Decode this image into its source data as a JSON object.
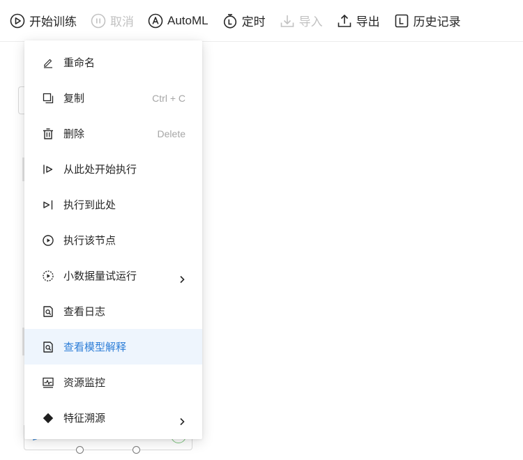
{
  "toolbar": {
    "start_training": "开始训练",
    "cancel": "取消",
    "automl": "AutoML",
    "schedule": "定时",
    "import": "导入",
    "export": "导出",
    "history": "历史记录"
  },
  "context_menu": {
    "items": [
      {
        "label": "重命名",
        "icon": "pencil-icon"
      },
      {
        "label": "复制",
        "shortcut": "Ctrl + C",
        "icon": "copy-icon"
      },
      {
        "label": "删除",
        "shortcut": "Delete",
        "icon": "trash-icon"
      },
      {
        "label": "从此处开始执行",
        "icon": "run-from-here-icon"
      },
      {
        "label": "执行到此处",
        "icon": "run-to-here-icon"
      },
      {
        "label": "执行该节点",
        "icon": "play-circle-icon"
      },
      {
        "label": "小数据量试运行",
        "icon": "dashed-play-circle-icon",
        "submenu": true
      },
      {
        "label": "查看日志",
        "icon": "log-search-icon"
      },
      {
        "label": "查看模型解释",
        "icon": "model-search-icon",
        "active": true
      },
      {
        "label": "资源监控",
        "icon": "monitor-icon"
      },
      {
        "label": "特征溯源",
        "icon": "diamond-icon",
        "submenu": true
      }
    ]
  },
  "colors": {
    "accent": "#2f7fd8",
    "active_bg": "#eef5fd",
    "disabled": "#c2c2c2"
  }
}
